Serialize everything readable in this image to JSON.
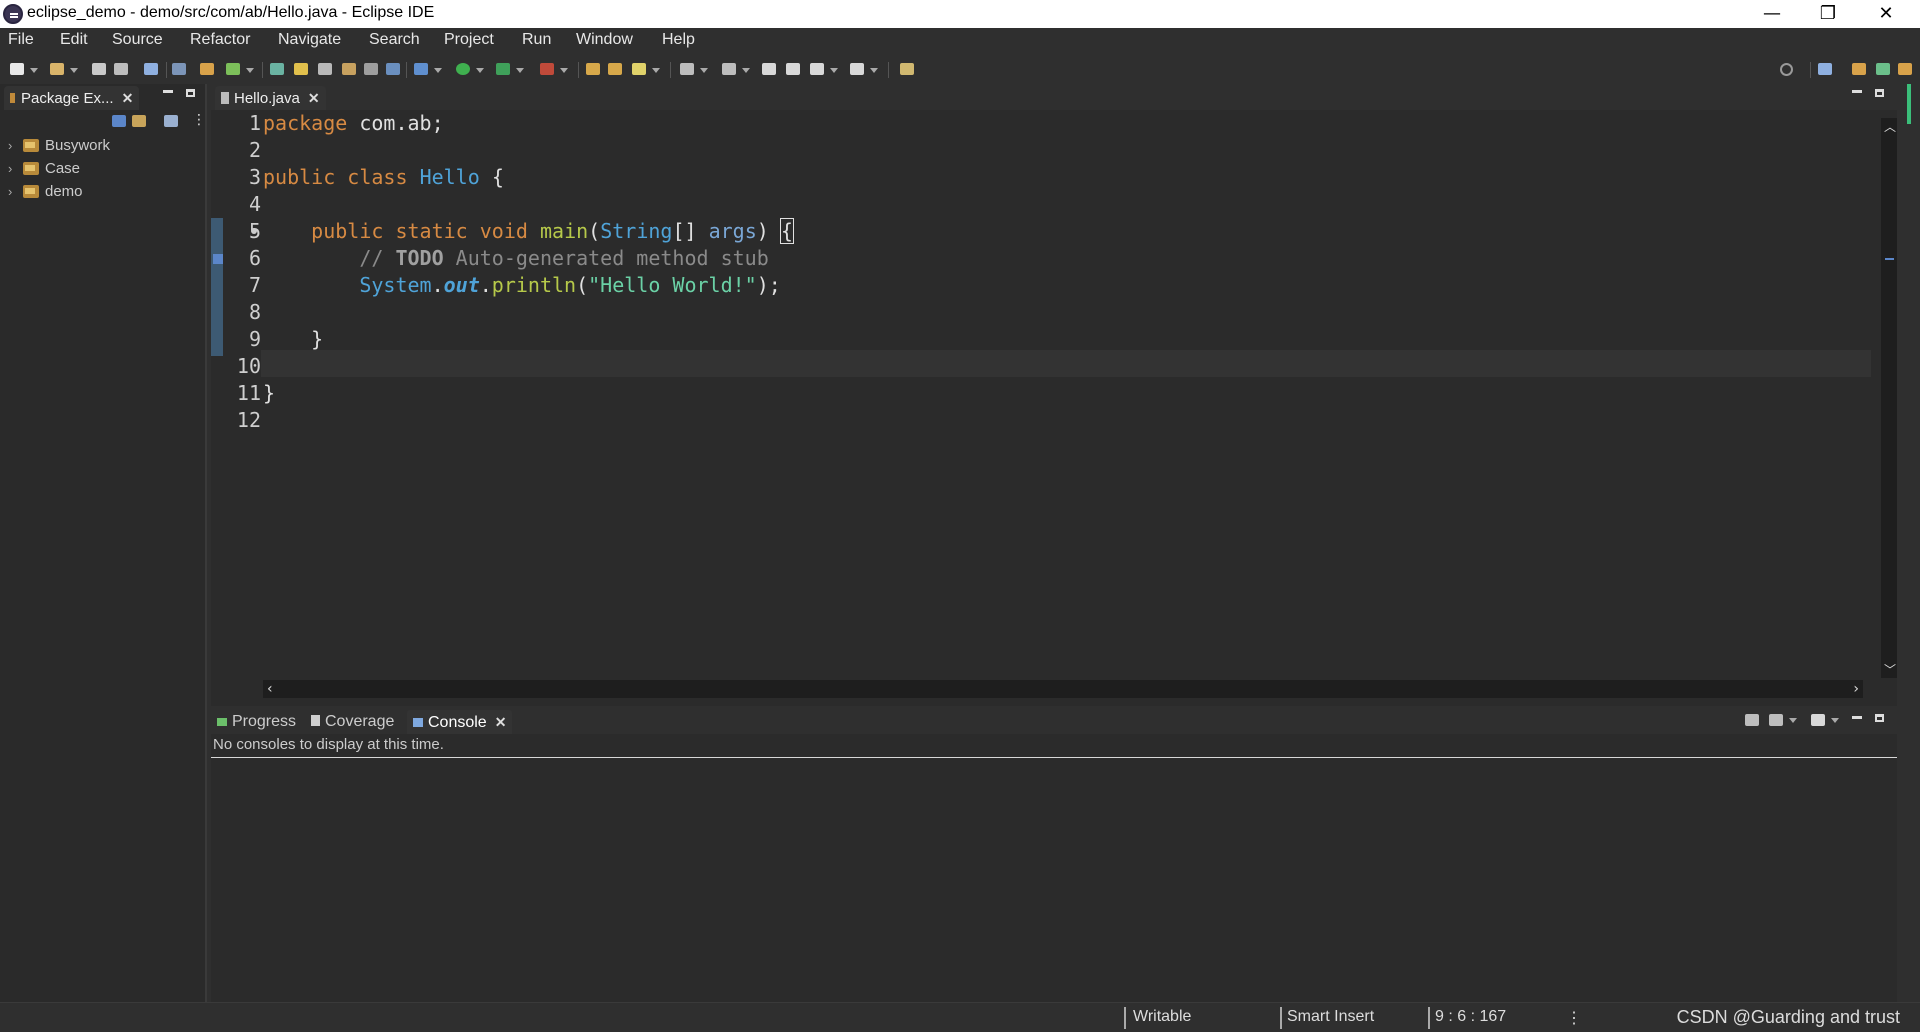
{
  "window": {
    "title": "eclipse_demo - demo/src/com/ab/Hello.java - Eclipse IDE",
    "minimize": "—",
    "restore": "❐",
    "close": "✕"
  },
  "menu": [
    "File",
    "Edit",
    "Source",
    "Refactor",
    "Navigate",
    "Search",
    "Project",
    "Run",
    "Window",
    "Help"
  ],
  "package_explorer": {
    "tab_label": "Package Ex...",
    "projects": [
      "Busywork",
      "Case",
      "demo"
    ]
  },
  "editor": {
    "tab_label": "Hello.java",
    "line_numbers": [
      "1",
      "2",
      "3",
      "4",
      "5",
      "6",
      "7",
      "8",
      "9",
      "10",
      "11",
      "12"
    ],
    "code": {
      "l1_kw": "package",
      "l1_rest": " com.ab;",
      "l3_kw1": "public",
      "l3_kw2": "class",
      "l3_name": "Hello",
      "l3_rest": " {",
      "l5_kw1": "public",
      "l5_kw2": "static",
      "l5_kw3": "void",
      "l5_fn": "main",
      "l5_p1": "(",
      "l5_type": "String",
      "l5_p2": "[] ",
      "l5_arg": "args",
      "l5_p3": ") ",
      "l5_brace": "{",
      "l6_cm1": "// ",
      "l6_todo": "TODO",
      "l6_cm2": " Auto-generated method stub",
      "l7_type": "System",
      "l7_dot1": ".",
      "l7_field": "out",
      "l7_dot2": ".",
      "l7_fn": "println",
      "l7_p1": "(",
      "l7_str": "\"Hello World!\"",
      "l7_p2": ");",
      "l9": "}",
      "l11": "}"
    }
  },
  "bottom_panel": {
    "tabs": [
      "Progress",
      "Coverage",
      "Console"
    ],
    "active_tab": "Console",
    "message": "No consoles to display at this time."
  },
  "status": {
    "writable": "Writable",
    "insert_mode": "Smart Insert",
    "position": "9 : 6 : 167",
    "watermark": "CSDN @Guarding and trust"
  },
  "colors": {
    "keyword": "#d78a43",
    "type": "#4fa3d8",
    "method": "#b6c94a",
    "string": "#6bd1a6",
    "comment": "#8a8a8a",
    "background": "#2b2b2b"
  }
}
